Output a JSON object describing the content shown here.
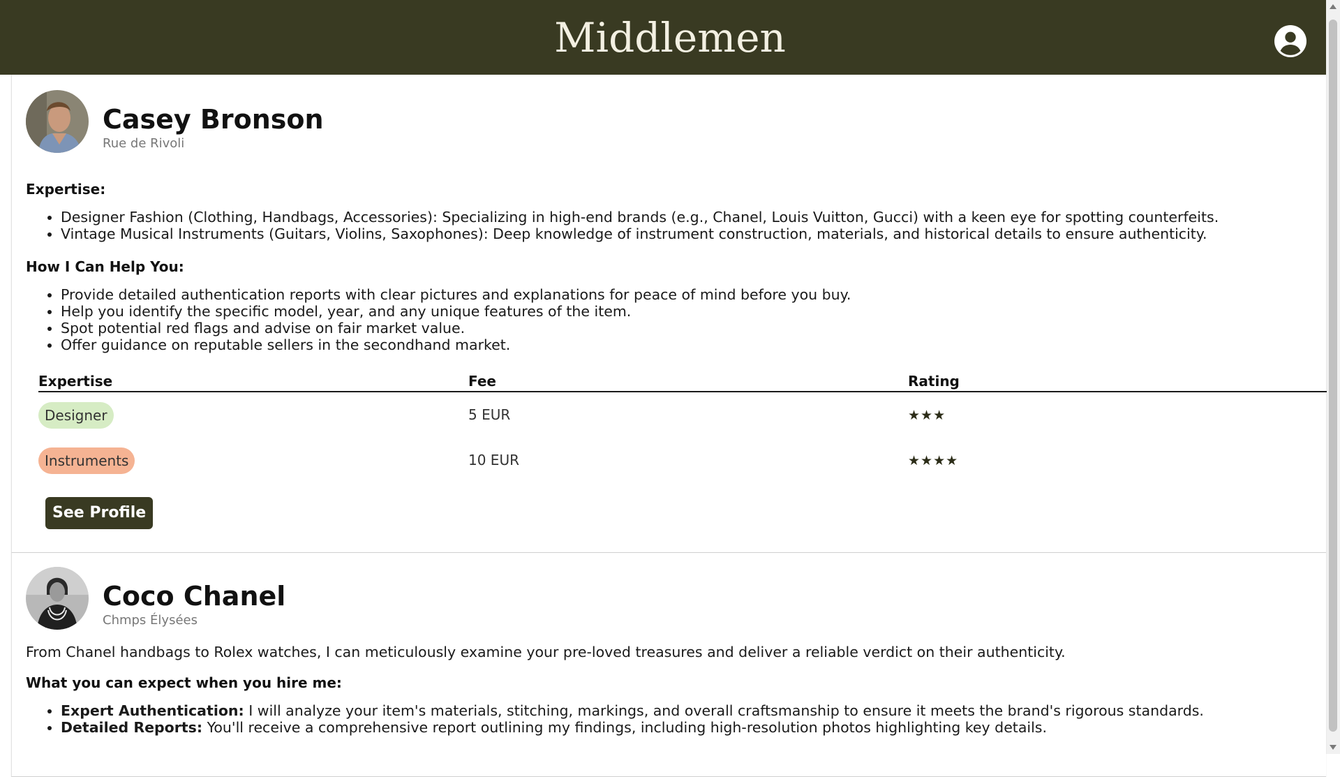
{
  "header": {
    "brand": "Middlemen",
    "account_icon": "account-circle-icon"
  },
  "profiles": [
    {
      "name": "Casey Bronson",
      "location": "Rue de Rivoli",
      "expertise_heading": "Expertise:",
      "expertise_items": [
        "Designer Fashion (Clothing, Handbags, Accessories): Specializing in high-end brands (e.g., Chanel, Louis Vuitton, Gucci) with a keen eye for spotting counterfeits.",
        "Vintage Musical Instruments (Guitars, Violins, Saxophones): Deep knowledge of instrument construction, materials, and historical details to ensure authenticity."
      ],
      "help_heading": "How I Can Help You:",
      "help_items": [
        "Provide detailed authentication reports with clear pictures and explanations for peace of mind before you buy.",
        "Help you identify the specific model, year, and any unique features of the item.",
        "Spot potential red flags and advise on fair market value.",
        "Offer guidance on reputable sellers in the secondhand market."
      ],
      "table": {
        "headers": {
          "expertise": "Expertise",
          "fee": "Fee",
          "rating": "Rating"
        },
        "rows": [
          {
            "expertise": "Designer",
            "fee": "5 EUR",
            "rating": "★★★",
            "stars": 3,
            "pill_color": "#d6ecc4"
          },
          {
            "expertise": "Instruments",
            "fee": "10 EUR",
            "rating": "★★★★",
            "stars": 4,
            "pill_color": "#f5b393"
          }
        ]
      },
      "button_label": "See Profile"
    },
    {
      "name": "Coco Chanel",
      "location": "Chmps Élysées",
      "intro": "From Chanel handbags to Rolex watches, I can meticulously examine your pre-loved treasures and deliver a reliable verdict on their authenticity.",
      "expect_heading": "What you can expect when you hire me:",
      "expect_items": [
        {
          "lead": "Expert Authentication:",
          "text": " I will analyze your item's materials, stitching, markings, and overall craftsmanship to ensure it meets the brand's rigorous standards."
        },
        {
          "lead": "Detailed Reports:",
          "text": " You'll receive a comprehensive report outlining my findings, including high-resolution photos highlighting key details."
        }
      ]
    }
  ],
  "colors": {
    "header_bg": "#393a22",
    "brand_text": "#f3f0e2",
    "button_bg": "#393a22"
  }
}
